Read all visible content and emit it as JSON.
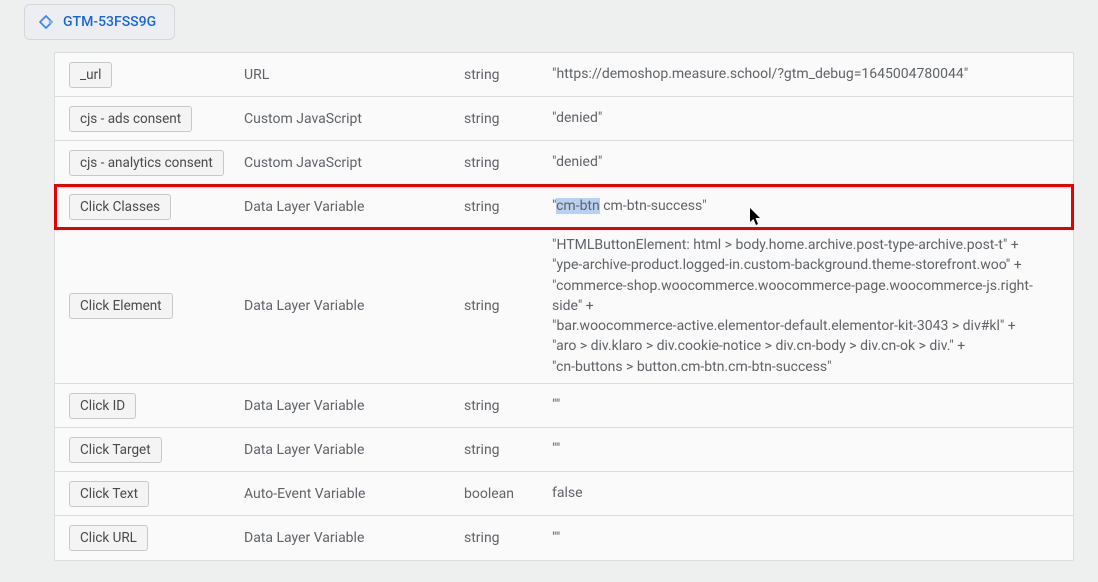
{
  "tab": {
    "label": "GTM-53FSS9G"
  },
  "variables": [
    {
      "name": "_url",
      "type": "URL",
      "valueType": "string",
      "value": "\"https://demoshop.measure.school/?gtm_debug=1645004780044\""
    },
    {
      "name": "cjs - ads consent",
      "type": "Custom JavaScript",
      "valueType": "string",
      "value": "\"denied\""
    },
    {
      "name": "cjs - analytics consent",
      "type": "Custom JavaScript",
      "valueType": "string",
      "value": "\"denied\""
    },
    {
      "name": "Click Classes",
      "type": "Data Layer Variable",
      "valueType": "string",
      "valuePrefix": "\"",
      "valueHighlight": "cm-btn",
      "valueSuffix": " cm-btn-success\""
    },
    {
      "name": "Click Element",
      "type": "Data Layer Variable",
      "valueType": "string",
      "valueLines": [
        "\"HTMLButtonElement: html > body.home.archive.post-type-archive.post-t\" +",
        "\"ype-archive-product.logged-in.custom-background.theme-storefront.woo\" +",
        "\"commerce-shop.woocommerce.woocommerce-page.woocommerce-js.right-side\" +",
        "\"bar.woocommerce-active.elementor-default.elementor-kit-3043 > div#kl\" +",
        "\"aro > div.klaro > div.cookie-notice > div.cn-body > div.cn-ok > div.\" +",
        "\"cn-buttons > button.cm-btn.cm-btn-success\""
      ]
    },
    {
      "name": "Click ID",
      "type": "Data Layer Variable",
      "valueType": "string",
      "value": "\"\""
    },
    {
      "name": "Click Target",
      "type": "Data Layer Variable",
      "valueType": "string",
      "value": "\"\""
    },
    {
      "name": "Click Text",
      "type": "Auto-Event Variable",
      "valueType": "boolean",
      "value": "false"
    },
    {
      "name": "Click URL",
      "type": "Data Layer Variable",
      "valueType": "string",
      "value": "\"\""
    }
  ]
}
